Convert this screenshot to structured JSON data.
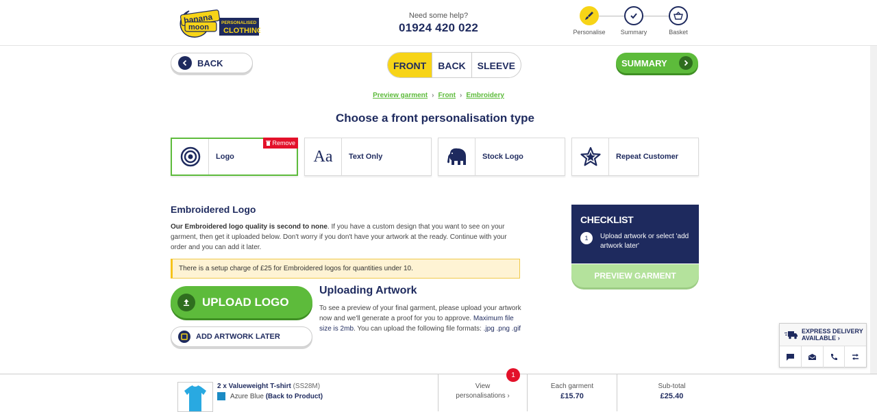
{
  "brand": {
    "logo_word1": "banana",
    "logo_word2": "moon",
    "logo_tag1": "PERSONALISED",
    "logo_tag2": "CLOTHING"
  },
  "help": {
    "label": "Need some help?",
    "phone": "01924 420 022"
  },
  "steps": [
    {
      "label": "Personalise",
      "icon": "paintbrush-icon"
    },
    {
      "label": "Summary",
      "icon": "check-icon"
    },
    {
      "label": "Basket",
      "icon": "basket-icon"
    }
  ],
  "toolbar": {
    "back_label": "BACK",
    "tabs": [
      "FRONT",
      "BACK",
      "SLEEVE"
    ],
    "summary_label": "SUMMARY"
  },
  "breadcrumb": [
    "Preview garment",
    "Front",
    "Embroidery"
  ],
  "page_title": "Choose a front personalisation type",
  "types": [
    {
      "label": "Logo",
      "icon": "target-icon",
      "selected": true
    },
    {
      "label": "Text Only",
      "icon": "text-aa-icon"
    },
    {
      "label": "Stock Logo",
      "icon": "elephant-icon"
    },
    {
      "label": "Repeat Customer",
      "icon": "star-icon"
    }
  ],
  "remove_label": "Remove",
  "section": {
    "title": "Embroidered Logo",
    "desc_bold": "Our Embroidered logo quality is second to none",
    "desc_rest": ". If you have a custom design that you want to see on your garment, then get it uploaded below. Don't worry if you don't have your artwork at the ready. Continue with your order and you can add it later.",
    "notice": "There is a setup charge of £25 for Embroidered logos for quantities under 10."
  },
  "upload": {
    "button": "UPLOAD LOGO",
    "later": "ADD ARTWORK LATER",
    "title": "Uploading Artwork",
    "desc1": "To see a preview of your final garment, please upload your artwork now and we'll generate a proof for you to approve. ",
    "desc_hl": "Maximum file size is 2mb",
    "desc2": ". You can upload the following file formats: ",
    "formats": ".jpg .png .gif"
  },
  "checklist": {
    "title": "CHECKLIST",
    "items": [
      {
        "num": "1",
        "text": "Upload artwork or select 'add artwork later'"
      }
    ],
    "preview_label": "PREVIEW GARMENT"
  },
  "contact": {
    "express_line1": "EXPRESS DELIVERY",
    "express_line2": "AVAILABLE",
    "icons": [
      "chat-icon",
      "mail-icon",
      "phone-icon",
      "transfer-icon"
    ]
  },
  "footer": {
    "product_qty_name": "2 x Valueweight T-shirt",
    "product_code": "(SS28M)",
    "color_name": "Azure Blue",
    "back_link": "(Back to Product)",
    "view_label1": "View",
    "view_label2": "personalisations",
    "badge": "1",
    "each_label": "Each garment",
    "each_value": "£15.70",
    "subtotal_label": "Sub-total",
    "subtotal_value": "£25.40"
  },
  "colors": {
    "navy": "#1e2a5e",
    "yellow": "#f7d417",
    "green": "#5dbb3b",
    "red": "#e3112a",
    "azure": "#1b8bc4"
  }
}
